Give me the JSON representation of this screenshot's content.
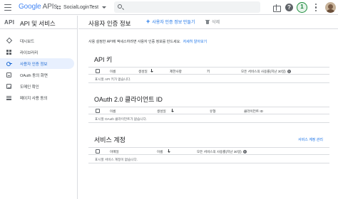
{
  "topbar": {
    "logo_google": "Google",
    "logo_apis": "APIs",
    "project_name": "SocialLoginTest",
    "badge_label": "1",
    "help_label": "?"
  },
  "sidebar": {
    "api_mark": "API",
    "title": "API 및 서비스",
    "items": [
      {
        "label": "대시보드",
        "icon": "diamond-icon"
      },
      {
        "label": "라이브러리",
        "icon": "library-icon"
      },
      {
        "label": "사용자 인증 정보",
        "icon": "key-icon",
        "active": true
      },
      {
        "label": "OAuth 동의 화면",
        "icon": "consent-icon"
      },
      {
        "label": "도메인 확인",
        "icon": "verify-icon"
      },
      {
        "label": "페이지 사용 동의",
        "icon": "settings-icon"
      }
    ]
  },
  "header": {
    "title": "사용자 인증 정보",
    "create_label": "사용자 인증 정보 만들기",
    "delete_label": "삭제"
  },
  "main": {
    "intro_text": "사용 설정한 API에 액세스하려면 사용자 인증 정보를 만드세요.",
    "intro_link": "자세히 알아보기",
    "api_keys": {
      "title": "API 키",
      "columns": [
        "이름",
        "생성일",
        "제한사항",
        "키",
        "모든 서비스의 사용률(지난 30일)"
      ],
      "empty": "표시할 API 키가 없습니다."
    },
    "oauth": {
      "title": "OAuth 2.0 클라이언트 ID",
      "columns": [
        "이름",
        "생성일",
        "유형",
        "클라이언트 ID"
      ],
      "empty": "표시할 OAuth 클라이언트가 없습니다."
    },
    "service_accounts": {
      "title": "서비스 계정",
      "manage_link": "서비스 계정 관리",
      "columns": [
        "이메일",
        "이름",
        "모든 서비스의 사용률(지난 30일)"
      ],
      "empty": "표시할 서비스 계정이 없습니다."
    }
  }
}
